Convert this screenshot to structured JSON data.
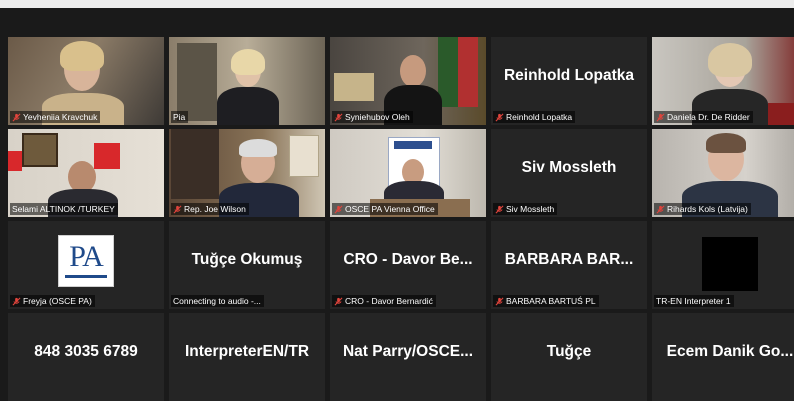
{
  "colors": {
    "active_border": "#c5e26a",
    "mic_muted": "#e0443c",
    "tile_bg": "#252525"
  },
  "tiles": [
    {
      "label": "Yevheniia Kravchuk",
      "muted": true
    },
    {
      "label": "Pia",
      "muted": false,
      "active": true
    },
    {
      "label": "Syniehubov Oleh",
      "muted": true
    },
    {
      "label": "Reinhold Lopatka",
      "display_name": "Reinhold Lopatka",
      "muted": true
    },
    {
      "label": "Daniela Dr. De Ridder",
      "muted": true
    },
    {
      "label": "Selami ALTINOK /TURKEY",
      "muted": true
    },
    {
      "label": "Rep. Joe Wilson",
      "muted": true
    },
    {
      "label": "OSCE PA Vienna Office",
      "muted": true
    },
    {
      "label": "Siv Mossleth",
      "display_name": "Siv Mossleth",
      "muted": true
    },
    {
      "label": "Rihards Kols (Latvija)",
      "muted": true
    },
    {
      "label": "Freyja (OSCE PA)",
      "muted": true,
      "logo": "PA"
    },
    {
      "label": "Connecting to audio -...",
      "display_name": "Tuğçe Okumuş",
      "muted": false
    },
    {
      "label": "CRO - Davor Bernardić",
      "display_name": "CRO - Davor Be...",
      "muted": true
    },
    {
      "label": "BARBARA BARTUŚ PL",
      "display_name": "BARBARA BAR...",
      "muted": true
    },
    {
      "label": "TR-EN Interpreter 1",
      "muted": false
    },
    {
      "display_name": "848 3035 6789"
    },
    {
      "display_name": "InterpreterEN/TR"
    },
    {
      "display_name": "Nat Parry/OSCE..."
    },
    {
      "display_name": "Tuğçe"
    },
    {
      "display_name": "Ecem Danik Go..."
    }
  ]
}
